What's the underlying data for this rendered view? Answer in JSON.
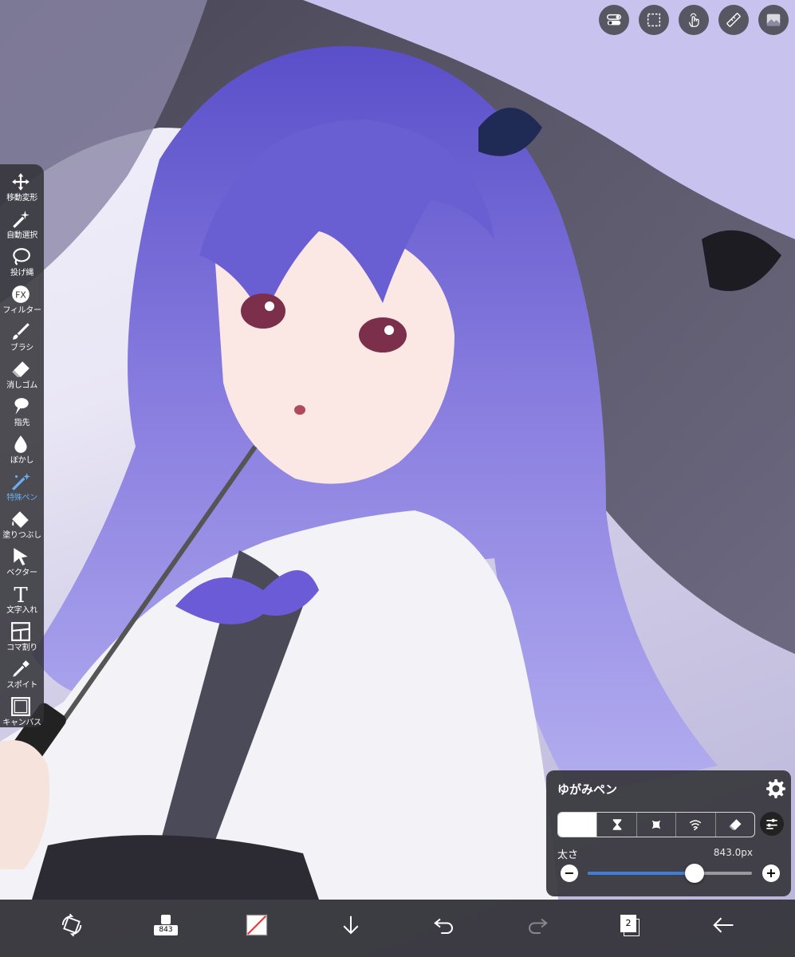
{
  "top_toolbar": {
    "icons": [
      "toggle-icon",
      "selection-icon",
      "touch-gesture-icon",
      "ruler-icon",
      "layer-preview-icon"
    ]
  },
  "tool_palette": {
    "tools": [
      {
        "label": "移動変形",
        "icon": "move-transform-icon"
      },
      {
        "label": "自動選択",
        "icon": "magic-wand-icon"
      },
      {
        "label": "投げ縄",
        "icon": "lasso-icon"
      },
      {
        "label": "フィルター",
        "icon": "filter-fx-icon"
      },
      {
        "label": "ブラシ",
        "icon": "brush-icon"
      },
      {
        "label": "消しゴム",
        "icon": "eraser-icon"
      },
      {
        "label": "指先",
        "icon": "smudge-icon"
      },
      {
        "label": "ぼかし",
        "icon": "blur-drop-icon"
      },
      {
        "label": "特殊ペン",
        "icon": "special-pen-icon"
      },
      {
        "label": "塗りつぶし",
        "icon": "bucket-fill-icon"
      },
      {
        "label": "ベクター",
        "icon": "vector-arrow-icon"
      },
      {
        "label": "文字入れ",
        "icon": "text-icon"
      },
      {
        "label": "コマ割り",
        "icon": "frame-divider-icon"
      },
      {
        "label": "スポイト",
        "icon": "eyedropper-icon"
      },
      {
        "label": "キャンバス",
        "icon": "canvas-icon"
      }
    ],
    "active_index": 8
  },
  "brush_panel": {
    "name": "ゆがみペン",
    "modes": [
      "push-mode-icon",
      "pinch-mode-icon",
      "swell-mode-icon",
      "twirl-mode-icon",
      "restore-mode-icon"
    ],
    "selected_mode": 0,
    "size_label": "太さ",
    "size_value": "843.0px",
    "size_fraction": 0.65,
    "minus": "−",
    "plus": "+"
  },
  "bottom_bar": {
    "brush_size_chip": "843",
    "layer_count": "2",
    "icons": [
      "transform-rotate-icon",
      "brush-size-icon",
      "color-swatch-icon",
      "download-icon",
      "undo-icon",
      "redo-icon",
      "layers-icon",
      "back-arrow-icon"
    ]
  },
  "colors": {
    "accent": "#3d7fd9",
    "active_tool": "#6aaef0",
    "panel_bg": "#37373c"
  }
}
